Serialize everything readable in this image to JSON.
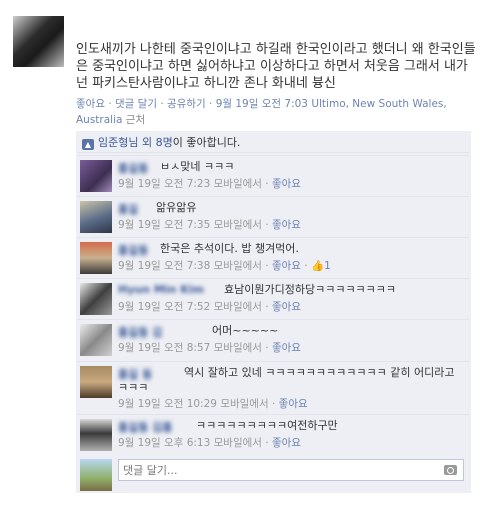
{
  "post": {
    "poster_name": "",
    "text": "인도새끼가 나한테 중국인이냐고 하길래 한국인이라고 했더니 왜 한국인들은 중국인이냐고 하면 싫어하냐고 이상하다고 하면서 처웃음 그래서 내가 넌 파키스탄사람이냐고 하니깐 존나 화내네 븅신",
    "like_label": "좋아요",
    "comment_label": "댓글 달기",
    "share_label": "공유하기",
    "timestamp": "9월 19일 오전 7:03",
    "via": "Ultimo, New South Wales, Australia",
    "nearby": "근처",
    "separator": "·"
  },
  "likes": {
    "names": "임준형님 외 8명",
    "suffix": "이 좋아합니다."
  },
  "comments": [
    {
      "text": "ㅂㅅ맞네 ㅋㅋㅋ",
      "time": "9월 19일 오전 7:23",
      "device": "모바일에서",
      "like_label": "좋아요",
      "like_count": ""
    },
    {
      "text": "앎유앎유",
      "time": "9월 19일 오전 7:35",
      "device": "모바일에서",
      "like_label": "좋아요",
      "like_count": ""
    },
    {
      "text": "한국은 추석이다. 밥 챙겨먹어.",
      "time": "9월 19일 오전 7:38",
      "device": "모바일에서",
      "like_label": "좋아요",
      "like_count": "1"
    },
    {
      "text": "효남이뭔가디정하당ㅋㅋㅋㅋㅋㅋㅋㅋ",
      "time": "9월 19일 오전 7:52",
      "device": "모바일에서",
      "like_label": "좋아요",
      "like_count": ""
    },
    {
      "text": "어머~~~~~",
      "time": "9월 19일 오전 8:57",
      "device": "모바일에서",
      "like_label": "좋아요",
      "like_count": ""
    },
    {
      "text": "역시 잘하고 있네 ㅋㅋㅋㅋㅋㅋㅋㅋㅋㅋㅋㅋ 같히 어디라고 ㅋㅋㅋ",
      "time": "9월 19일 오전 10:29",
      "device": "모바일에서",
      "like_label": "좋아요",
      "like_count": ""
    },
    {
      "text": "ㅋㅋㅋㅋㅋㅋㅋㅋㅋ여전하구만",
      "time": "9월 19일 오후 6:13",
      "device": "모바일에서",
      "like_label": "좋아요",
      "like_count": ""
    }
  ],
  "reply": {
    "placeholder": "댓글 달기..."
  },
  "colors": {
    "link": "#3b5998",
    "panel_bg": "#edeff4",
    "meta": "#999999"
  },
  "icons": {
    "like": "thumbs-up-icon",
    "camera": "camera-icon"
  }
}
